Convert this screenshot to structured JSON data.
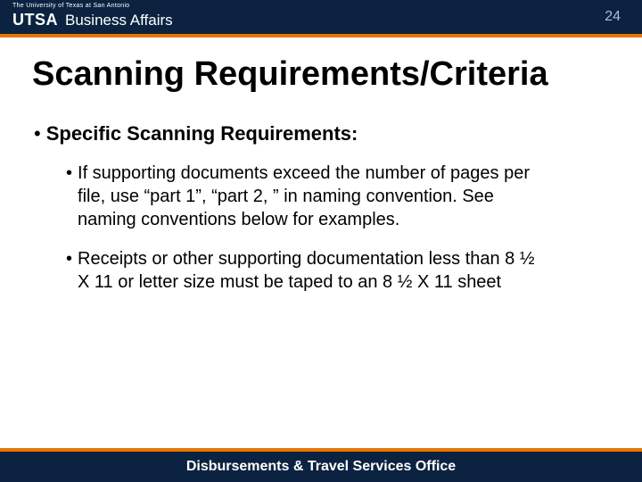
{
  "header": {
    "tagline": "The University of Texas at San Antonio",
    "logo_bold": "UTSA",
    "logo_rest": "Business Affairs",
    "page_number": "24"
  },
  "title": "Scanning Requirements/Criteria",
  "body": {
    "level1": {
      "bullet": "•",
      "text": "Specific Scanning Requirements:"
    },
    "level2": [
      {
        "bullet": "•",
        "text": "If supporting documents exceed the number of pages per file, use “part 1”, “part 2, ” in naming convention. See naming conventions below for examples."
      },
      {
        "bullet": "•",
        "text": "Receipts or other supporting documentation less than 8 ½ X 11 or letter size must be taped to an 8 ½ X 11 sheet"
      }
    ]
  },
  "footer": {
    "text": "Disbursements & Travel Services Office"
  }
}
